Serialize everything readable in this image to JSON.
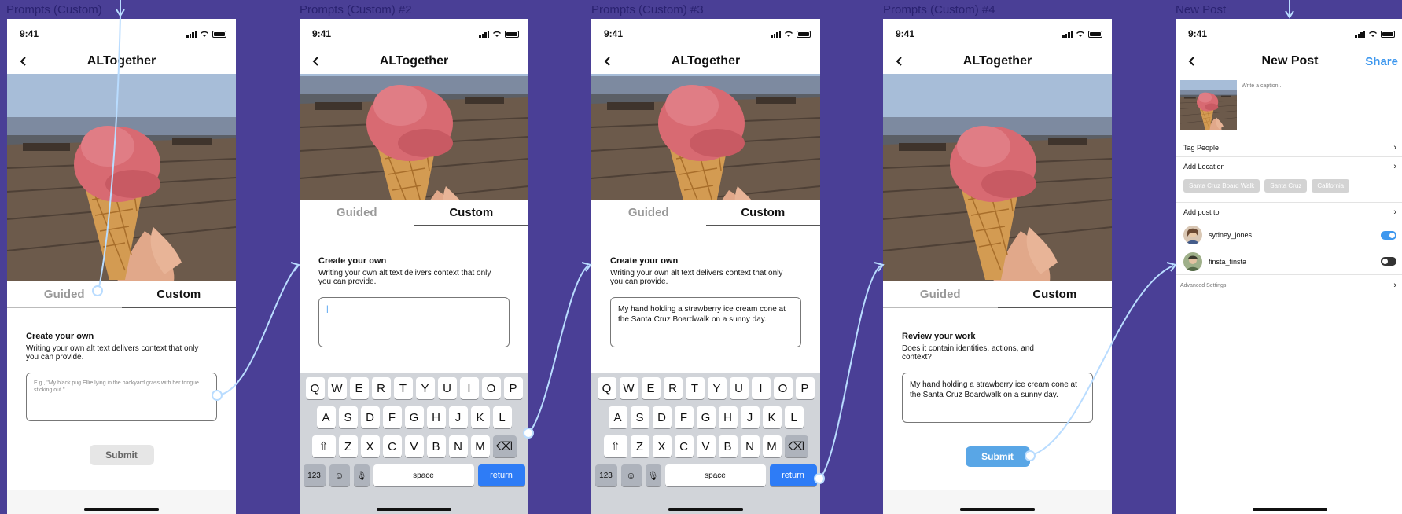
{
  "frames": [
    {
      "label": "Prompts (Custom)"
    },
    {
      "label": "Prompts (Custom) #2"
    },
    {
      "label": "Prompts (Custom) #3"
    },
    {
      "label": "Prompts (Custom) #4"
    },
    {
      "label": "New Post"
    }
  ],
  "status": {
    "time": "9:41"
  },
  "app": {
    "title": "ALTogether"
  },
  "tabs": {
    "guided": "Guided",
    "custom": "Custom"
  },
  "create": {
    "title": "Create your own",
    "desc": "Writing your own alt text delivers context that only you can provide.",
    "placeholder": "E.g., \"My black pug Ellie lying in the backyard grass with her tongue sticking out.\"",
    "typed": "My hand holding a strawberry ice cream cone at the Santa Cruz Boardwalk on a sunny day."
  },
  "review": {
    "title": "Review your work",
    "desc": "Does it contain identities, actions, and context?"
  },
  "submit_label": "Submit",
  "keyboard": {
    "row1": [
      "Q",
      "W",
      "E",
      "R",
      "T",
      "Y",
      "U",
      "I",
      "O",
      "P"
    ],
    "row2": [
      "A",
      "S",
      "D",
      "F",
      "G",
      "H",
      "J",
      "K",
      "L"
    ],
    "row3": [
      "Z",
      "X",
      "C",
      "V",
      "B",
      "N",
      "M"
    ],
    "k123": "123",
    "space": "space",
    "return": "return"
  },
  "new_post": {
    "title": "New Post",
    "share": "Share",
    "caption_placeholder": "Write a caption...",
    "tag_people": "Tag People",
    "add_location": "Add Location",
    "locations": [
      "Santa Cruz Board Walk",
      "Santa Cruz",
      "California"
    ],
    "add_post_to": "Add post to",
    "accounts": [
      {
        "name": "sydney_jones",
        "enabled": true
      },
      {
        "name": "finsta_finsta",
        "enabled": false
      }
    ],
    "advanced": "Advanced Settings"
  },
  "colors": {
    "background": "#4a3f96",
    "accent": "#3d97ee",
    "flow_line": "#b9dcff",
    "return_key": "#2e7cf6"
  }
}
